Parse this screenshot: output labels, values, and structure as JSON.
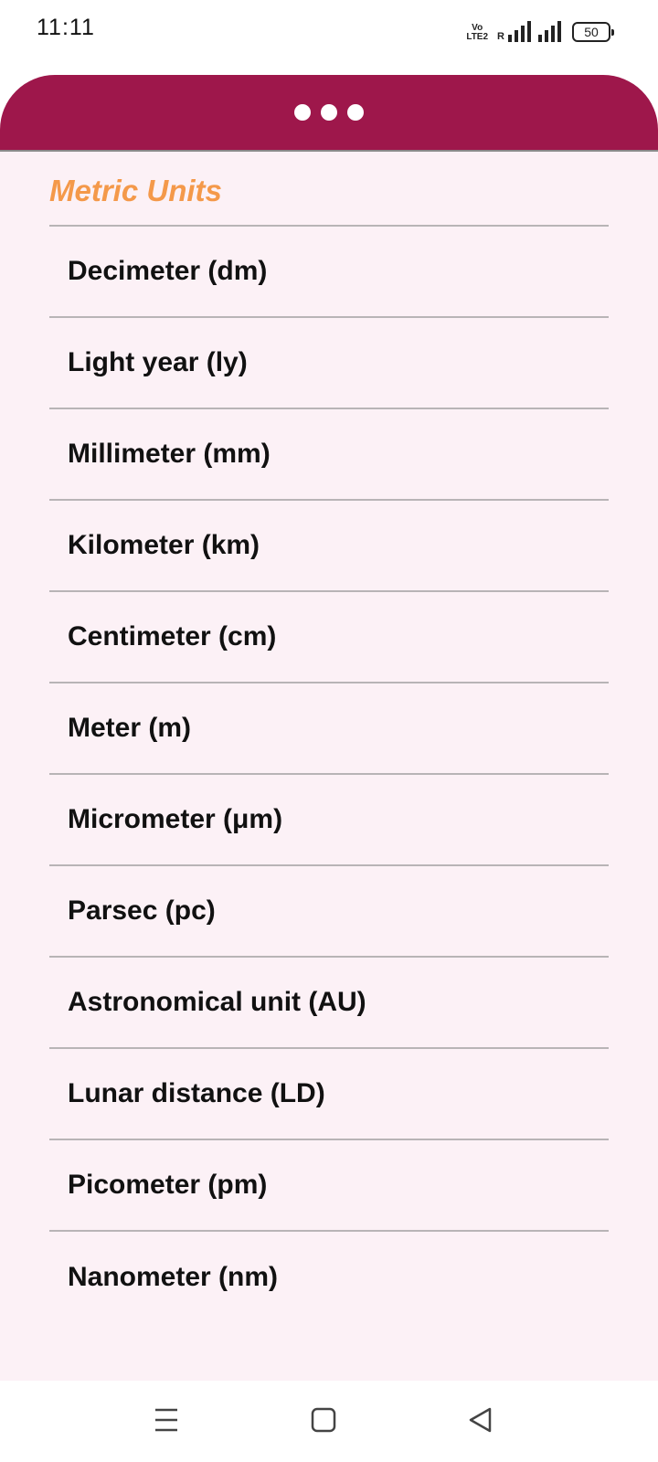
{
  "status_bar": {
    "time": "11:11",
    "volte_line1": "Vo",
    "volte_line2": "LTE2",
    "roaming": "R",
    "battery": "50"
  },
  "header": {
    "menu_icon": "more-dots-icon"
  },
  "section": {
    "title": "Metric Units"
  },
  "units": [
    "Decimeter (dm)",
    "Light year (ly)",
    "Millimeter (mm)",
    "Kilometer (km)",
    "Centimeter (cm)",
    "Meter (m)",
    "Micrometer (μm)",
    "Parsec (pc)",
    "Astronomical unit (AU)",
    "Lunar distance (LD)",
    "Picometer (pm)",
    "Nanometer (nm)"
  ],
  "nav": {
    "recents_icon": "menu-lines-icon",
    "home_icon": "square-home-icon",
    "back_icon": "triangle-back-icon"
  },
  "colors": {
    "header": "#9e174b",
    "title": "#f4994a",
    "background": "#fcf1f6"
  }
}
